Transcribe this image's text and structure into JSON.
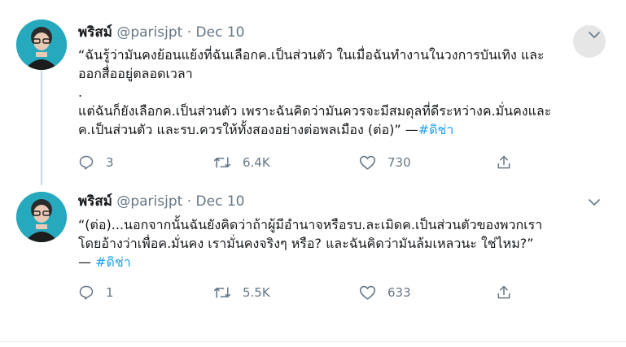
{
  "tweets": [
    {
      "author": {
        "name": "พริสม์",
        "handle": "@parisjpt",
        "separator": "·",
        "date": "Dec 10"
      },
      "lines": [
        "“ฉันรู้ว่ามันคงย้อนแย้งที่ฉันเลือกค.เป็นส่วนตัว ในเมื่อฉันทำงานในวงการบันเทิง และ",
        "ออกสื่ออยู่ตลอดเวลา",
        ".",
        "แต่ฉันก็ยังเลือกค.เป็นส่วนตัว เพราะฉันคิดว่ามันควรจะมีสมดุลที่ดีระหว่างค.มั่นคงและ",
        "ค.เป็นส่วนตัว และรบ.ควรให้ทั้งสองอย่างต่อพลเมือง (ต่อ)” —"
      ],
      "hashtag": "#ดิช่า",
      "counts": {
        "replies": "3",
        "retweets": "6.4K",
        "likes": "730"
      }
    },
    {
      "author": {
        "name": "พริสม์",
        "handle": "@parisjpt",
        "separator": "·",
        "date": "Dec 10"
      },
      "lines": [
        "“(ต่อ)...นอกจากนั้นฉันยังคิดว่าถ้าผู้มีอำนาจหรือรบ.ละเมิดค.เป็นส่วนตัวของพวกเรา",
        "โดยอ้างว่าเพื่อค.มั่นคง เรามั่นคงจริงๆ หรือ? และฉันคิดว่ามันล้มเหลวนะ ใช่ไหม?”",
        "— "
      ],
      "hashtag": "#ดิช่า",
      "counts": {
        "replies": "1",
        "retweets": "5.5K",
        "likes": "633"
      }
    }
  ],
  "colors": {
    "hashtag": "#1da1f2",
    "meta": "#657786",
    "text": "#14171a"
  },
  "icons": [
    "chevron-down-icon",
    "reply-icon",
    "retweet-icon",
    "like-icon",
    "share-icon"
  ]
}
